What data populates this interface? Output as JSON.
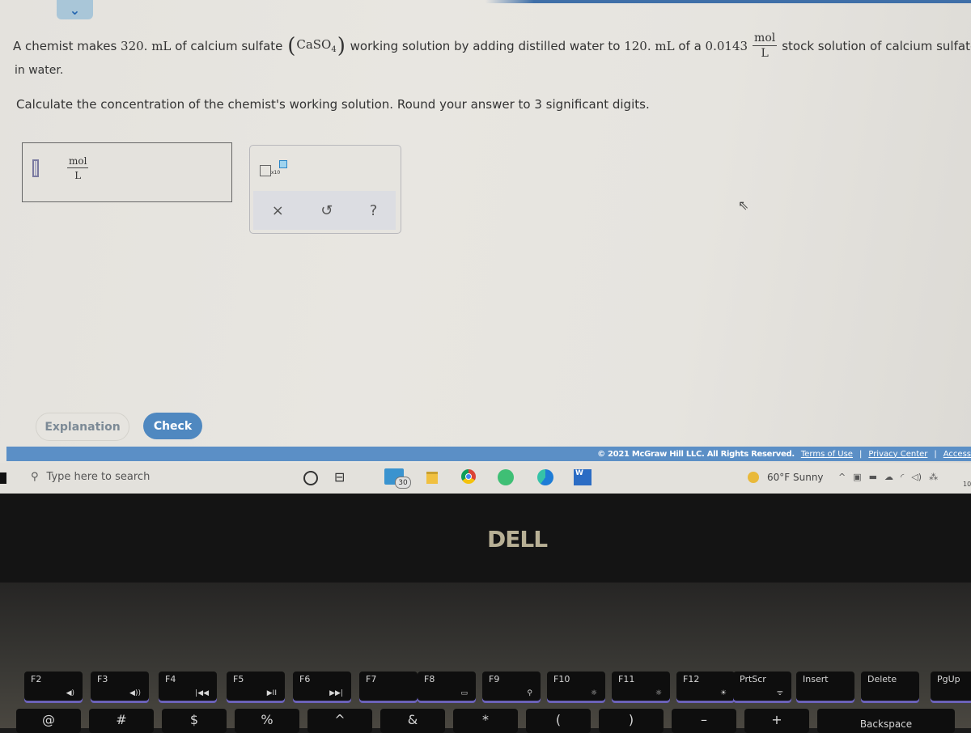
{
  "question": {
    "line1_part1": "A chemist makes",
    "volume_working": "320. mL",
    "line1_part2": "of calcium sulfate",
    "formula_base": "CaSO",
    "formula_sub": "4",
    "line1_part3": "working solution by adding distilled water to",
    "volume_stock": "120. mL",
    "line1_part4": "of a",
    "stock_conc": "0.0143",
    "unit_num": "mol",
    "unit_den": "L",
    "line1_part5": "stock solution of calcium sulfate",
    "line1_cont": "in water.",
    "line2": "Calculate the concentration of the chemist's working solution. Round your answer to 3 significant digits."
  },
  "answer": {
    "value": "",
    "unit_num": "mol",
    "unit_den": "L"
  },
  "tools": {
    "sci_notation_label": "x10",
    "clear_icon": "×",
    "undo_icon": "↺",
    "help_icon": "?"
  },
  "buttons": {
    "explanation": "Explanation",
    "check": "Check"
  },
  "footer": {
    "copyright": "© 2021 McGraw Hill LLC. All Rights Reserved.",
    "terms": "Terms of Use",
    "privacy": "Privacy Center",
    "accessibility": "Access",
    "separator": "|"
  },
  "taskbar": {
    "search_placeholder": "Type here to search",
    "mail_badge": "30",
    "word_label": "W",
    "weather": "60°F  Sunny",
    "clock_partial": "10"
  },
  "laptop": {
    "brand": "DELL",
    "fkeys": [
      {
        "label": "F2",
        "sub": "◀)"
      },
      {
        "label": "F3",
        "sub": "◀))"
      },
      {
        "label": "F4",
        "sub": "|◀◀"
      },
      {
        "label": "F5",
        "sub": "▶II"
      },
      {
        "label": "F6",
        "sub": "▶▶|"
      },
      {
        "label": "F7",
        "sub": ""
      },
      {
        "label": "F8",
        "sub": "▭"
      },
      {
        "label": "F9",
        "sub": "⚲"
      },
      {
        "label": "F10",
        "sub": "☼"
      },
      {
        "label": "F11",
        "sub": "☼"
      },
      {
        "label": "F12",
        "sub": "☀"
      },
      {
        "label": "PrtScr",
        "sub": "ᯤ"
      },
      {
        "label": "Insert",
        "sub": ""
      },
      {
        "label": "Delete",
        "sub": ""
      },
      {
        "label": "PgUp",
        "sub": ""
      }
    ],
    "row2": [
      "@",
      "#",
      "$",
      "%",
      "^",
      "&",
      "*",
      "(",
      ")",
      "–",
      "+",
      "Backspace"
    ]
  }
}
